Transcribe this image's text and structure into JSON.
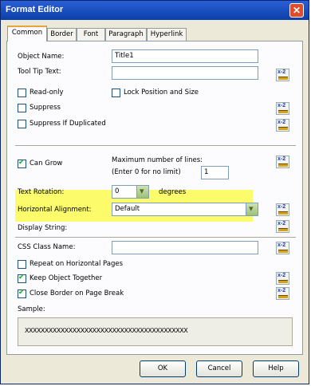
{
  "window": {
    "title": "Format Editor",
    "close_glyph": "✕"
  },
  "tabs": [
    "Common",
    "Border",
    "Font",
    "Paragraph",
    "Hyperlink"
  ],
  "fields": {
    "object_name_label": "Object Name:",
    "object_name_value": "Title1",
    "tooltip_label": "Tool Tip Text:",
    "tooltip_value": "",
    "readonly_label": "Read-only",
    "lock_label": "Lock Position and Size",
    "suppress_label": "Suppress",
    "suppress_dup_label": "Suppress If Duplicated",
    "can_grow_label": "Can Grow",
    "max_lines_label": "Maximum number of lines:",
    "max_lines_hint": "(Enter 0 for no limit)",
    "max_lines_value": "1",
    "rotation_label": "Text Rotation:",
    "rotation_value": "0",
    "rotation_unit": "degrees",
    "halign_label": "Horizontal Alignment:",
    "halign_value": "Default",
    "display_string_label": "Display String:",
    "css_label": "CSS Class Name:",
    "css_value": "",
    "repeat_label": "Repeat on Horizontal Pages",
    "keep_together_label": "Keep Object Together",
    "close_border_label": "Close Border on Page Break",
    "sample_label": "Sample:",
    "sample_text": "XXXXXXXXXXXXXXXXXXXXXXXXXXXXXXXXXXXXXXXXX"
  },
  "formula_button_text": "x-2",
  "checkbox_states": {
    "readonly": false,
    "lock": false,
    "suppress": false,
    "suppress_dup": false,
    "can_grow": true,
    "repeat": false,
    "keep_together": true,
    "close_border": true
  },
  "buttons": {
    "ok": "OK",
    "cancel": "Cancel",
    "help": "Help"
  },
  "colors": {
    "highlight": "#fbfb6b",
    "titlebar": "#0b3fa8",
    "tab_accent": "#e8a33c"
  },
  "icons": {
    "formula": "formula-editor-icon",
    "dropdown": "chevron-down-icon",
    "close": "close-icon"
  }
}
